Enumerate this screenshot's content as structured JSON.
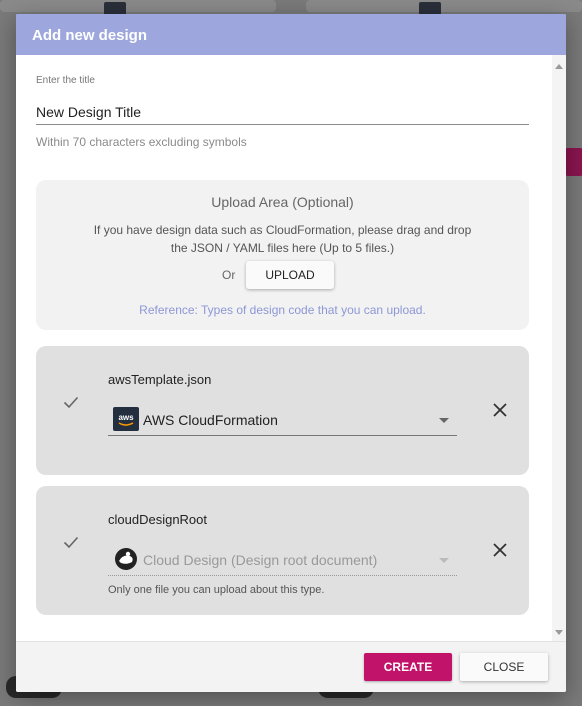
{
  "dialog": {
    "title": "Add new design"
  },
  "form": {
    "title_label": "Enter the title",
    "title_value": "New Design Title",
    "helper_text": "Within 70 characters excluding symbols"
  },
  "upload": {
    "title": "Upload Area (Optional)",
    "description": "If you have design data such as CloudFormation, please drag and drop the JSON / YAML files here (Up to 5 files.)",
    "or_label": "Or",
    "button_label": "UPLOAD",
    "reference_link": "Reference: Types of design code that you can upload."
  },
  "files": [
    {
      "name": "awsTemplate.json",
      "type": "AWS CloudFormation",
      "icon": "aws-logo-icon",
      "disabled": false,
      "note": ""
    },
    {
      "name": "cloudDesignRoot",
      "type": "Cloud Design (Design root document)",
      "icon": "cloud-design-icon",
      "disabled": true,
      "note": "Only one file you can upload about this type."
    }
  ],
  "footer": {
    "create_label": "CREATE",
    "close_label": "CLOSE"
  },
  "colors": {
    "header": "#9ea7dd",
    "primary": "#c2136b",
    "link": "#8d97d6"
  }
}
